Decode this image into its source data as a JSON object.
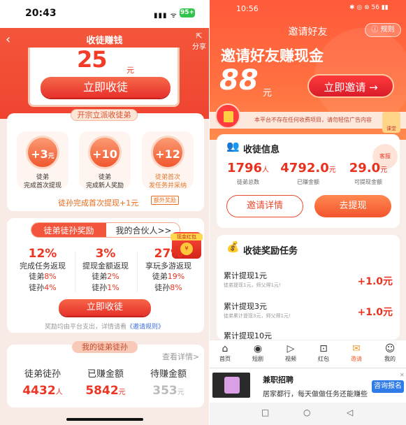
{
  "left": {
    "status": {
      "time": "20:43",
      "signal": "▮▮▮ ᯤ",
      "battery": "95+"
    },
    "header": {
      "back": "‹",
      "title": "收徒赚钱",
      "share_label": "分享",
      "share_icon": "⇱"
    },
    "hero": {
      "amount": "25",
      "unit": "元",
      "button": "立即收徒"
    },
    "section1": {
      "tag": "开宗立派收徒弟",
      "badges": [
        {
          "amount": "+3",
          "unit": "元",
          "line1": "徒弟",
          "line2": "完成首次提现"
        },
        {
          "amount": "+10",
          "unit": "元",
          "line1": "徒弟",
          "line2": "完成新人奖励"
        },
        {
          "amount": "+12",
          "unit": "元",
          "line1": "徒弟首次",
          "line2": "发任务并采纳"
        }
      ],
      "grandson_line": "徒孙完成首次提现+1元",
      "extra_badge": "额外奖励"
    },
    "section2": {
      "tab_active": "徒弟徒孙奖励",
      "tab_other": "我的合伙人>>",
      "red_packet_title": "现金红包",
      "red_packet_coin": "¥",
      "cols": [
        {
          "pct": "12%",
          "desc": "完成任务返现",
          "r1_label": "徒弟",
          "r1_val": "8%",
          "r2_label": "徒孙",
          "r2_val": "4%"
        },
        {
          "pct": "3%",
          "desc": "提现金额返现",
          "r1_label": "徒弟",
          "r1_val": "2%",
          "r2_label": "徒孙",
          "r2_val": "1%"
        },
        {
          "pct": "27%",
          "desc": "享玩多游返现",
          "r1_label": "徒弟",
          "r1_val": "19%",
          "r2_label": "徒孙",
          "r2_val": "8%"
        }
      ],
      "button": "立即收徒",
      "note": "奖励均由平台支出，详情请看",
      "note_link": "《邀请规则》"
    },
    "section3": {
      "tag": "我的徒弟徒孙",
      "more": "查看详情>",
      "stats": [
        {
          "label": "徒弟徒孙",
          "value": "4432",
          "unit": "人"
        },
        {
          "label": "已赚金额",
          "value": "5842",
          "unit": "元"
        },
        {
          "label": "待赚金额",
          "value": "353",
          "unit": "元"
        }
      ]
    }
  },
  "right": {
    "status": {
      "time": "10:56",
      "icons": "✱ ◎ ⊛ 56 ▮▮"
    },
    "header": {
      "title": "邀请好友",
      "rule": "ⓘ 规则"
    },
    "hero": {
      "headline": "邀请好友赚现金",
      "amount": "88",
      "unit": "元",
      "button": "立即邀请 →"
    },
    "notice": "本平台不存在任何收费项目，请勿轻信广告内容",
    "cap_label": "课堂",
    "info": {
      "title": "收徒信息",
      "kefu": "客服",
      "stats": [
        {
          "value": "1796",
          "unit": "人",
          "label": "徒弟总数"
        },
        {
          "value": "4792.0",
          "unit": "元",
          "label": "已赚金额"
        },
        {
          "value": "29.0",
          "unit": "元",
          "label": "可提现金额"
        }
      ],
      "btn_detail": "邀请详情",
      "btn_withdraw": "去提现"
    },
    "tasks": {
      "title": "收徒奖励任务",
      "items": [
        {
          "name": "累计提现1元",
          "desc": "徒弟提现1元，师父得1元!",
          "amount": "+1.0元"
        },
        {
          "name": "累计提现3元",
          "desc": "徒弟累计提现3元，师父得1元!",
          "amount": "+1.0元"
        },
        {
          "name": "累计提现10元",
          "desc": "",
          "amount": ""
        }
      ]
    },
    "nav": [
      {
        "icon": "⌂",
        "label": "首页"
      },
      {
        "icon": "◉",
        "label": "短剧"
      },
      {
        "icon": "▷",
        "label": "视频"
      },
      {
        "icon": "⊡",
        "label": "红包"
      },
      {
        "icon": "✉",
        "label": "邀请"
      },
      {
        "icon": "☺",
        "label": "我的"
      }
    ],
    "ad": {
      "title": "兼职招聘",
      "desc": "居家都行，每天做做任务还能赚些...",
      "button": "咨询报名",
      "close": "✕"
    },
    "sysnav": {
      "square": "□",
      "circle": "○",
      "back": "◁"
    }
  }
}
